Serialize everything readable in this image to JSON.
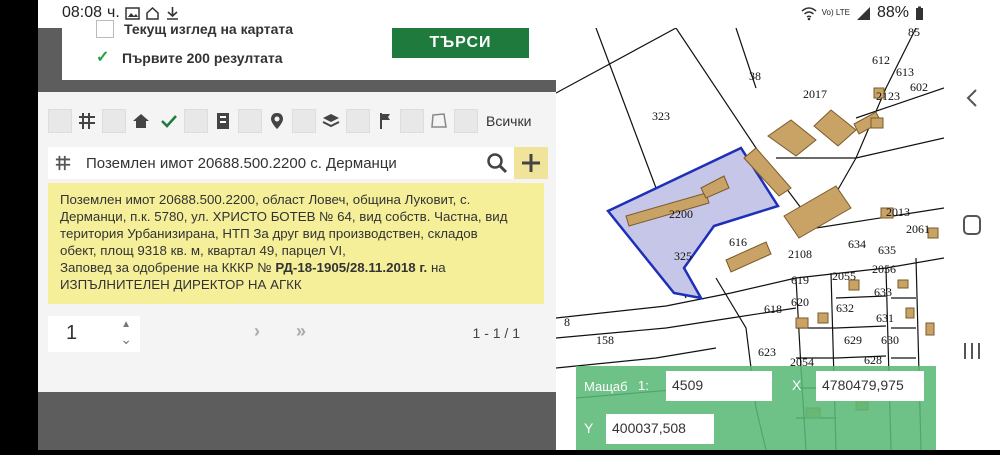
{
  "status_bar": {
    "time": "08:08",
    "carrier_suffix": "ч.",
    "network": "Vo) LTE",
    "battery": "88%"
  },
  "search_options": {
    "current_view_label": "Текущ изглед на картата",
    "first_200_label": "Първите 200 резултата",
    "search_button": "ТЪРСИ"
  },
  "filters": {
    "all_label": "Всички"
  },
  "result": {
    "title": "Поземлен имот 20688.500.2200 с. Дерманци",
    "info_line1": "Поземлен имот 20688.500.2200, област Ловеч, община Луковит, с.",
    "info_line2": "Дерманци, п.к. 5780, ул. ХРИСТО БОТЕВ № 64, вид собств. Частна, вид",
    "info_line3": "територия Урбанизирана, НТП За друг вид производствен, складов",
    "info_line4": "обект, площ 9318 кв. м, квартал 49, парцел VI,",
    "info_line5_prefix": "Заповед за одобрение на КККР №",
    "info_line5_bold": "РД-18-1905/28.11.2018 г.",
    "info_line5_suffix": "на",
    "info_line6": "ИЗПЪЛНИТЕЛЕН ДИРЕКТОР НА АГКК"
  },
  "pager": {
    "page": "1",
    "count": "1 - 1 / 1"
  },
  "map": {
    "parcel_labels": [
      "38",
      "323",
      "2017",
      "2200",
      "325",
      "616",
      "2108",
      "619",
      "620",
      "618",
      "623",
      "2054",
      "634",
      "635",
      "2055",
      "2056",
      "633",
      "632",
      "631",
      "629",
      "630",
      "628",
      "2013",
      "2061",
      "612",
      "613",
      "602",
      "2123",
      "85",
      "158",
      "8"
    ],
    "scale_label": "Мащаб",
    "scale_prefix": "1:",
    "scale_value": "4509",
    "x_label": "X",
    "x_value": "4780479,975",
    "y_label": "Y",
    "y_value": "400037,508"
  },
  "colors": {
    "accent_green": "#1f7a3e",
    "info_yellow": "#f6ef9a",
    "highlight_blue": "#1e2fb8",
    "building_tan": "#c9a266"
  }
}
